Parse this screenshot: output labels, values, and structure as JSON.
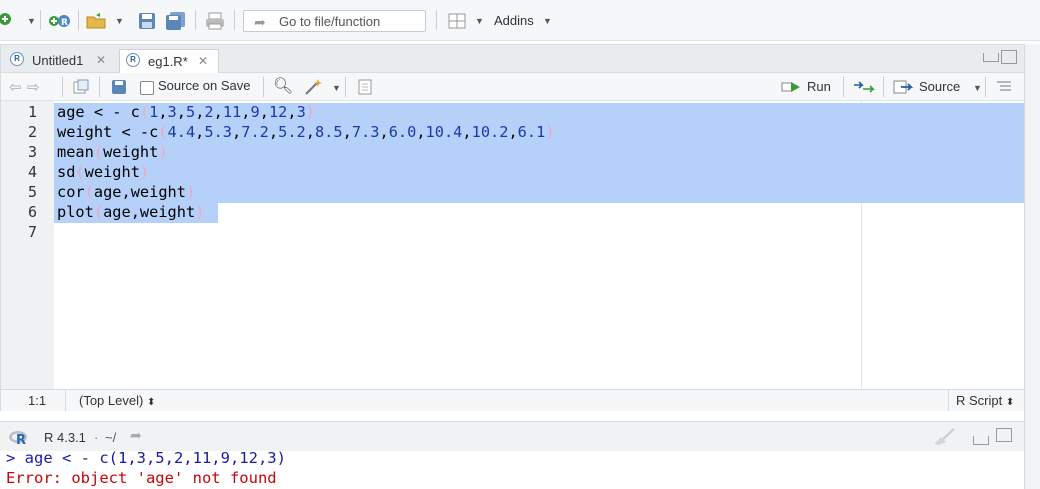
{
  "toolbar": {
    "goto_placeholder": "Go to file/function",
    "addins_label": "Addins"
  },
  "editor": {
    "tabs": [
      {
        "label": "Untitled1",
        "active": false
      },
      {
        "label": "eg1.R*",
        "active": true
      }
    ],
    "source_on_save_label": "Source on Save",
    "run_label": "Run",
    "source_label": "Source",
    "lines": [
      {
        "no": "1",
        "segments": [
          {
            "t": "age < - c"
          },
          {
            "t": "(",
            "c": "paren"
          },
          {
            "t": "1",
            "c": "num"
          },
          {
            "t": ","
          },
          {
            "t": "3",
            "c": "num"
          },
          {
            "t": ","
          },
          {
            "t": "5",
            "c": "num"
          },
          {
            "t": ","
          },
          {
            "t": "2",
            "c": "num"
          },
          {
            "t": ","
          },
          {
            "t": "11",
            "c": "num"
          },
          {
            "t": ","
          },
          {
            "t": "9",
            "c": "num"
          },
          {
            "t": ","
          },
          {
            "t": "12",
            "c": "num"
          },
          {
            "t": ","
          },
          {
            "t": "3",
            "c": "num"
          },
          {
            "t": ")",
            "c": "paren"
          }
        ]
      },
      {
        "no": "2",
        "segments": [
          {
            "t": "weight < -c"
          },
          {
            "t": "(",
            "c": "paren"
          },
          {
            "t": "4.4",
            "c": "num"
          },
          {
            "t": ","
          },
          {
            "t": "5.3",
            "c": "num"
          },
          {
            "t": ","
          },
          {
            "t": "7.2",
            "c": "num"
          },
          {
            "t": ","
          },
          {
            "t": "5.2",
            "c": "num"
          },
          {
            "t": ","
          },
          {
            "t": "8.5",
            "c": "num"
          },
          {
            "t": ","
          },
          {
            "t": "7.3",
            "c": "num"
          },
          {
            "t": ","
          },
          {
            "t": "6.0",
            "c": "num"
          },
          {
            "t": ","
          },
          {
            "t": "10.4",
            "c": "num"
          },
          {
            "t": ","
          },
          {
            "t": "10.2",
            "c": "num"
          },
          {
            "t": ","
          },
          {
            "t": "6.1",
            "c": "num"
          },
          {
            "t": ")",
            "c": "paren"
          }
        ]
      },
      {
        "no": "3",
        "segments": [
          {
            "t": "mean"
          },
          {
            "t": "(",
            "c": "paren"
          },
          {
            "t": "weight"
          },
          {
            "t": ")",
            "c": "paren"
          }
        ]
      },
      {
        "no": "4",
        "segments": [
          {
            "t": "sd"
          },
          {
            "t": "(",
            "c": "paren"
          },
          {
            "t": "weight"
          },
          {
            "t": ")",
            "c": "paren"
          }
        ]
      },
      {
        "no": "5",
        "segments": [
          {
            "t": "cor"
          },
          {
            "t": "(",
            "c": "paren"
          },
          {
            "t": "age,weight"
          },
          {
            "t": ")",
            "c": "paren"
          }
        ]
      },
      {
        "no": "6",
        "segments": [
          {
            "t": "plot"
          },
          {
            "t": "(",
            "c": "paren"
          },
          {
            "t": "age,weight"
          },
          {
            "t": ")",
            "c": "paren"
          }
        ]
      },
      {
        "no": "7",
        "segments": []
      }
    ],
    "status": {
      "position": "1:1",
      "scope": "(Top Level)",
      "file_type": "R Script"
    }
  },
  "console": {
    "r_version": "R 4.3.1",
    "path": "~/",
    "lines": [
      {
        "text": "> age < - c(1,3,5,2,11,9,12,3)",
        "color": "#1a1aa6"
      },
      {
        "text": "Error: object 'age' not found",
        "color": "#c5060b"
      }
    ]
  },
  "colors": {
    "selection": "#b5d1fa",
    "number": "#1a3aa8",
    "paren": "#f0a7bd",
    "error": "#c5060b"
  }
}
